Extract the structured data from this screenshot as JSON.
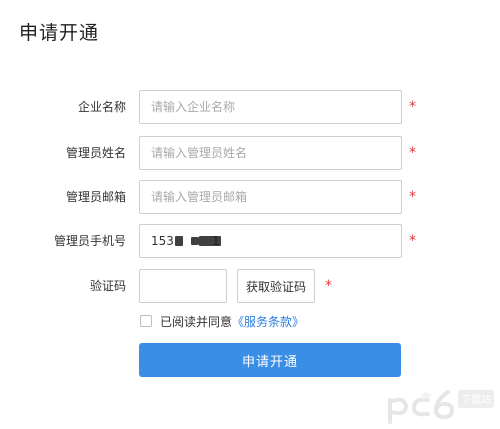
{
  "page": {
    "title": "申请开通"
  },
  "form": {
    "company": {
      "label": "企业名称",
      "placeholder": "请输入企业名称"
    },
    "admin_name": {
      "label": "管理员姓名",
      "placeholder": "请输入管理员姓名"
    },
    "admin_email": {
      "label": "管理员邮箱",
      "placeholder": "请输入管理员邮箱"
    },
    "admin_phone": {
      "label": "管理员手机号",
      "value": "153          1"
    },
    "captcha": {
      "label": "验证码",
      "value": "",
      "button_label": "获取验证码"
    },
    "required_mark": "*",
    "agreement": {
      "prefix": "已阅读并同意",
      "link_label": "《服务条款》"
    },
    "submit_label": "申请开通"
  },
  "colors": {
    "primary": "#3a8ee6",
    "required": "#e0393e",
    "link": "#2b7de0",
    "border": "#cfcfcf"
  },
  "watermark": {
    "text": "pc6",
    "badge": "下载站"
  }
}
